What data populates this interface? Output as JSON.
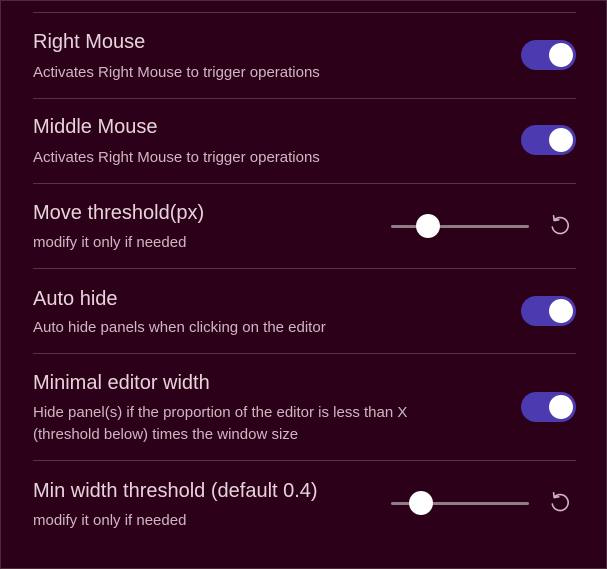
{
  "settings": {
    "right_mouse": {
      "name": "Right Mouse",
      "description": "Activates Right Mouse to trigger operations",
      "enabled": true
    },
    "middle_mouse": {
      "name": "Middle Mouse",
      "description": "Activates Right Mouse to trigger operations",
      "enabled": true
    },
    "move_threshold": {
      "name": "Move threshold(px)",
      "description": "modify it only if needed",
      "slider_fraction": 0.27,
      "reset_icon": "reset-icon"
    },
    "auto_hide": {
      "name": "Auto hide",
      "description": "Auto hide panels when clicking on the editor",
      "enabled": true
    },
    "minimal_editor_width": {
      "name": "Minimal editor width",
      "description": "Hide panel(s) if the proportion of the editor is less than X (threshold below) times the window size",
      "enabled": true
    },
    "min_width_threshold": {
      "name": "Min width threshold (default 0.4)",
      "description": "modify it only if needed",
      "slider_fraction": 0.22,
      "reset_icon": "reset-icon"
    }
  },
  "colors": {
    "background": "#2d0019",
    "toggle_on": "#4c3bb0",
    "divider": "#57334a"
  }
}
